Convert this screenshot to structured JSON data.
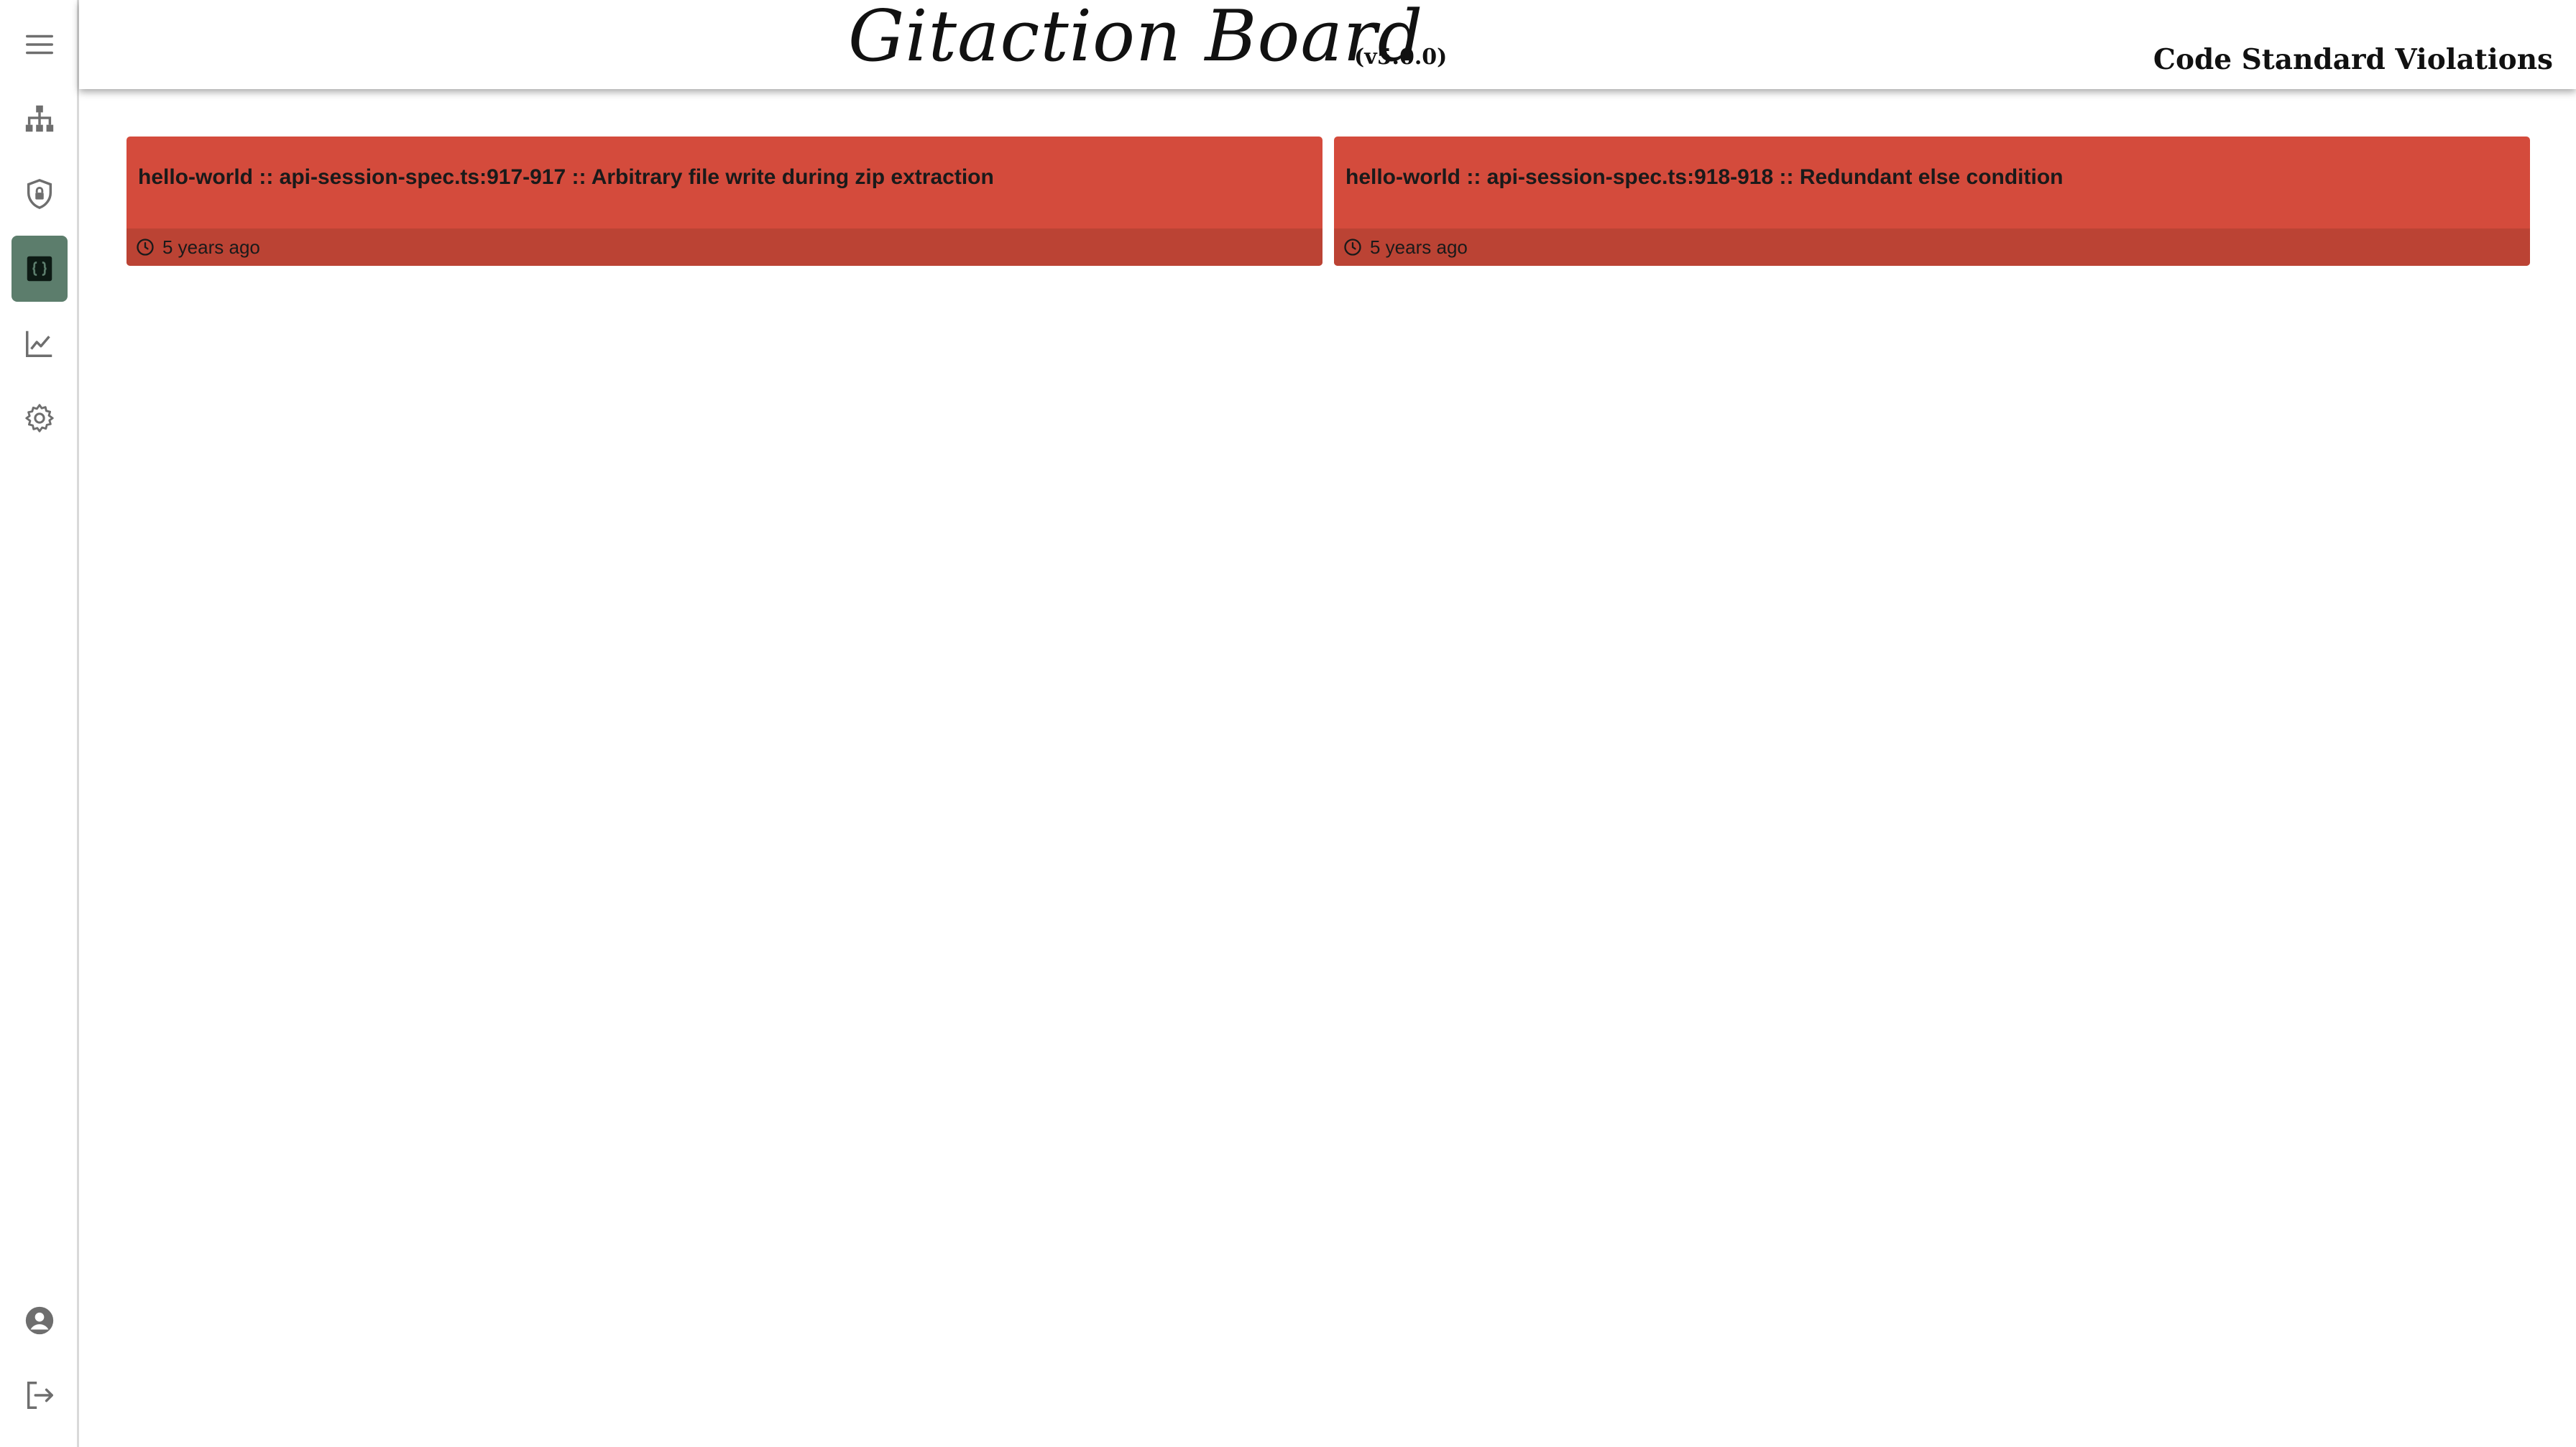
{
  "header": {
    "brand": "Gitaction Board",
    "version": "(v5.0.0)",
    "page_title": "Code Standard Violations"
  },
  "sidebar": {
    "items": [
      {
        "icon": "menu-icon"
      },
      {
        "icon": "sitemap-icon"
      },
      {
        "icon": "shield-lock-icon"
      },
      {
        "icon": "code-braces-icon",
        "active": true
      },
      {
        "icon": "chart-line-icon"
      },
      {
        "icon": "gear-icon"
      },
      {
        "icon": "account-icon"
      },
      {
        "icon": "logout-icon"
      }
    ]
  },
  "violations": [
    {
      "title": "hello-world :: api-session-spec.ts:917-917 :: Arbitrary file write during zip extraction",
      "time": "5 years ago"
    },
    {
      "title": "hello-world :: api-session-spec.ts:918-918 :: Redundant else condition",
      "time": "5 years ago"
    }
  ],
  "colors": {
    "card": "#d44b3c",
    "card_footer": "#bb4334",
    "active_nav": "#5c7d6c",
    "icon": "#6e6e6e"
  }
}
